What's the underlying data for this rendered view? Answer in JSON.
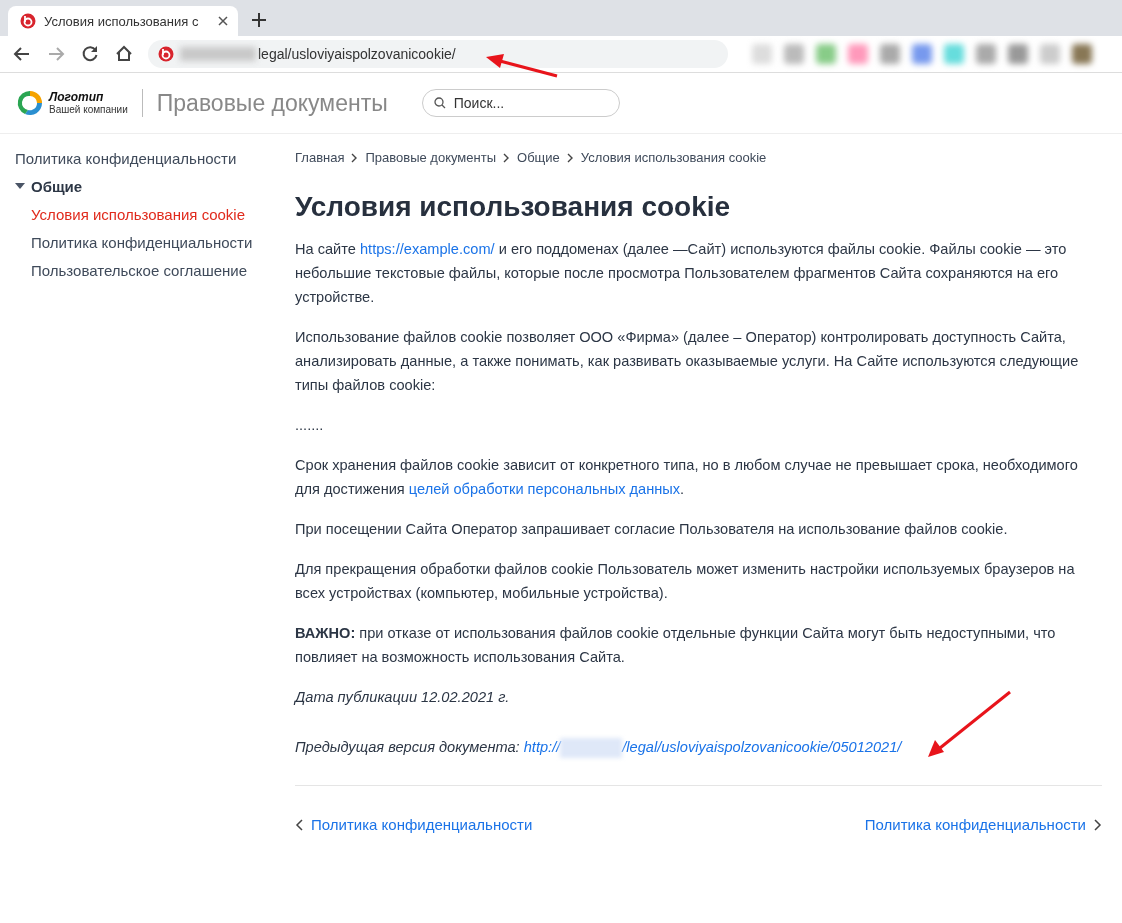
{
  "browser": {
    "tab": {
      "title": "Условия использования с",
      "selected": true
    },
    "address": {
      "url": "legal/usloviyaispolzovanicookie/"
    }
  },
  "header": {
    "logo": {
      "name": "Логотип",
      "subtitle": "Вашей компании"
    },
    "title": "Правовые документы",
    "search": {
      "placeholder": "Поиск..."
    }
  },
  "sidebar": {
    "items": [
      {
        "label": "Политика конфиденциальности",
        "selected": false
      },
      {
        "label": "Общие",
        "selected": false,
        "expanded": true,
        "children": [
          {
            "label": "Условия использования cookie",
            "selected": true
          },
          {
            "label": "Политика конфиденциальности",
            "selected": false
          },
          {
            "label": "Пользовательское соглашение",
            "selected": false
          }
        ]
      }
    ]
  },
  "breadcrumbs": [
    "Главная",
    "Правовые документы",
    "Общие",
    "Условия использования cookie"
  ],
  "article": {
    "title": "Условия использования cookie",
    "paragraphs": [
      {
        "kind": "text",
        "segments": [
          {
            "text": "На сайте "
          },
          {
            "text": "https://example.com/",
            "link": true
          },
          {
            "text": " и его поддоменах (далее —Сайт) используются файлы cookie. Файлы cookie — это небольшие текстовые файлы, которые после просмотра Пользователем фрагментов Сайта сохраняются на его устройстве."
          }
        ]
      },
      {
        "kind": "text",
        "segments": [
          {
            "text": "Использование файлов cookie позволяет ООО «Фирма» (далее – Оператор) контролировать доступность Сайта, анализировать данные, а также понимать, как развивать оказываемые услуги. На Сайте используются следующие типы файлов cookie:"
          }
        ]
      },
      {
        "kind": "text",
        "segments": [
          {
            "text": "......."
          }
        ]
      },
      {
        "kind": "text",
        "segments": [
          {
            "text": "Срок хранения файлов cookie зависит от конкретного типа, но в любом случае не превышает срока, необходимого для достижения "
          },
          {
            "text": "целей обработки персональных данных",
            "link": true
          },
          {
            "text": "."
          }
        ]
      },
      {
        "kind": "text",
        "segments": [
          {
            "text": "При посещении Сайта Оператор запрашивает согласие Пользователя на использование файлов cookie."
          }
        ]
      },
      {
        "kind": "text",
        "segments": [
          {
            "text": "Для прекращения обработки файлов cookie Пользователь может изменить настройки используемых браузеров на всех устройствах (компьютер, мобильные устройства)."
          }
        ]
      },
      {
        "kind": "text",
        "segments": [
          {
            "text": "**ВАЖНО:** при отказе от использования файлов cookie отдельные функции Сайта могут быть недоступными, что повлияет на возможность использования Сайта."
          }
        ]
      },
      {
        "kind": "italic",
        "segments": [
          {
            "text": "Дата публикации 12.02.2021 г."
          }
        ]
      },
      {
        "kind": "italic",
        "segments": [
          {
            "text": "Предыдущая версия документа: "
          },
          {
            "text": "http://",
            "link": true,
            "redacted_after": true
          },
          {
            "text": "/legal/usloviyaispolzovanicookie/05012021/",
            "link": true
          }
        ]
      }
    ]
  },
  "pager": {
    "previous": "Политика конфиденциальности",
    "next": "Политика конфиденциальности"
  }
}
